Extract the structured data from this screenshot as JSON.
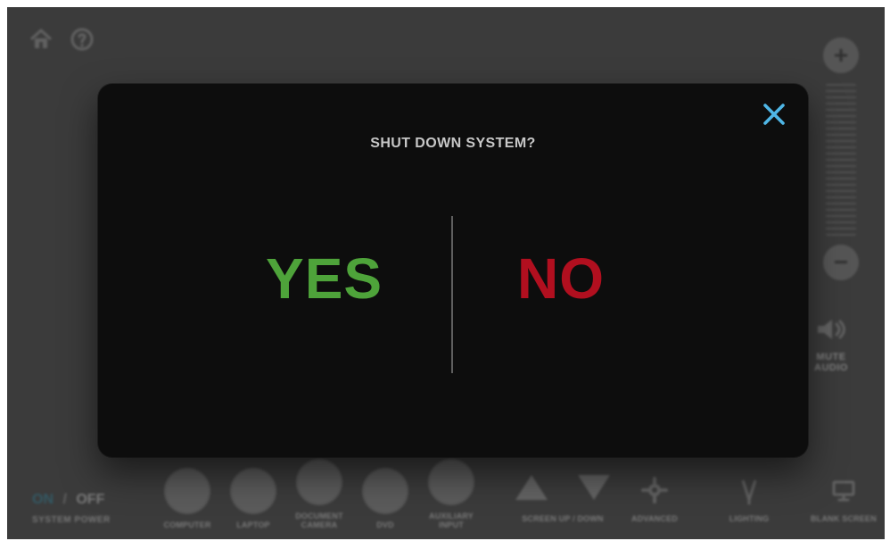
{
  "dialog": {
    "title": "SHUT DOWN SYSTEM?",
    "yes_label": "YES",
    "no_label": "NO",
    "close_icon": "close-icon",
    "colors": {
      "yes": "#4ea33a",
      "no": "#b10f1f",
      "close": "#4fb6e6"
    }
  },
  "background": {
    "top_left_icons": [
      "home-icon",
      "help-icon"
    ],
    "volume": {
      "plus_label": "+",
      "minus_label": "−"
    },
    "mute": {
      "label_line1": "MUTE",
      "label_line2": "AUDIO"
    },
    "system_power": {
      "on_label": "ON",
      "slash": "/",
      "off_label": "OFF",
      "caption": "SYSTEM POWER"
    },
    "sources": [
      {
        "label_line1": "COMPUTER",
        "label_line2": ""
      },
      {
        "label_line1": "LAPTOP",
        "label_line2": ""
      },
      {
        "label_line1": "DOCUMENT",
        "label_line2": "CAMERA"
      },
      {
        "label_line1": "DVD",
        "label_line2": ""
      },
      {
        "label_line1": "AUXILIARY",
        "label_line2": "INPUT"
      }
    ],
    "screen": {
      "label": "SCREEN UP / DOWN"
    },
    "right": {
      "advanced": "ADVANCED",
      "lighting": "LIGHTING",
      "blank_screen": "BLANK SCREEN"
    }
  }
}
